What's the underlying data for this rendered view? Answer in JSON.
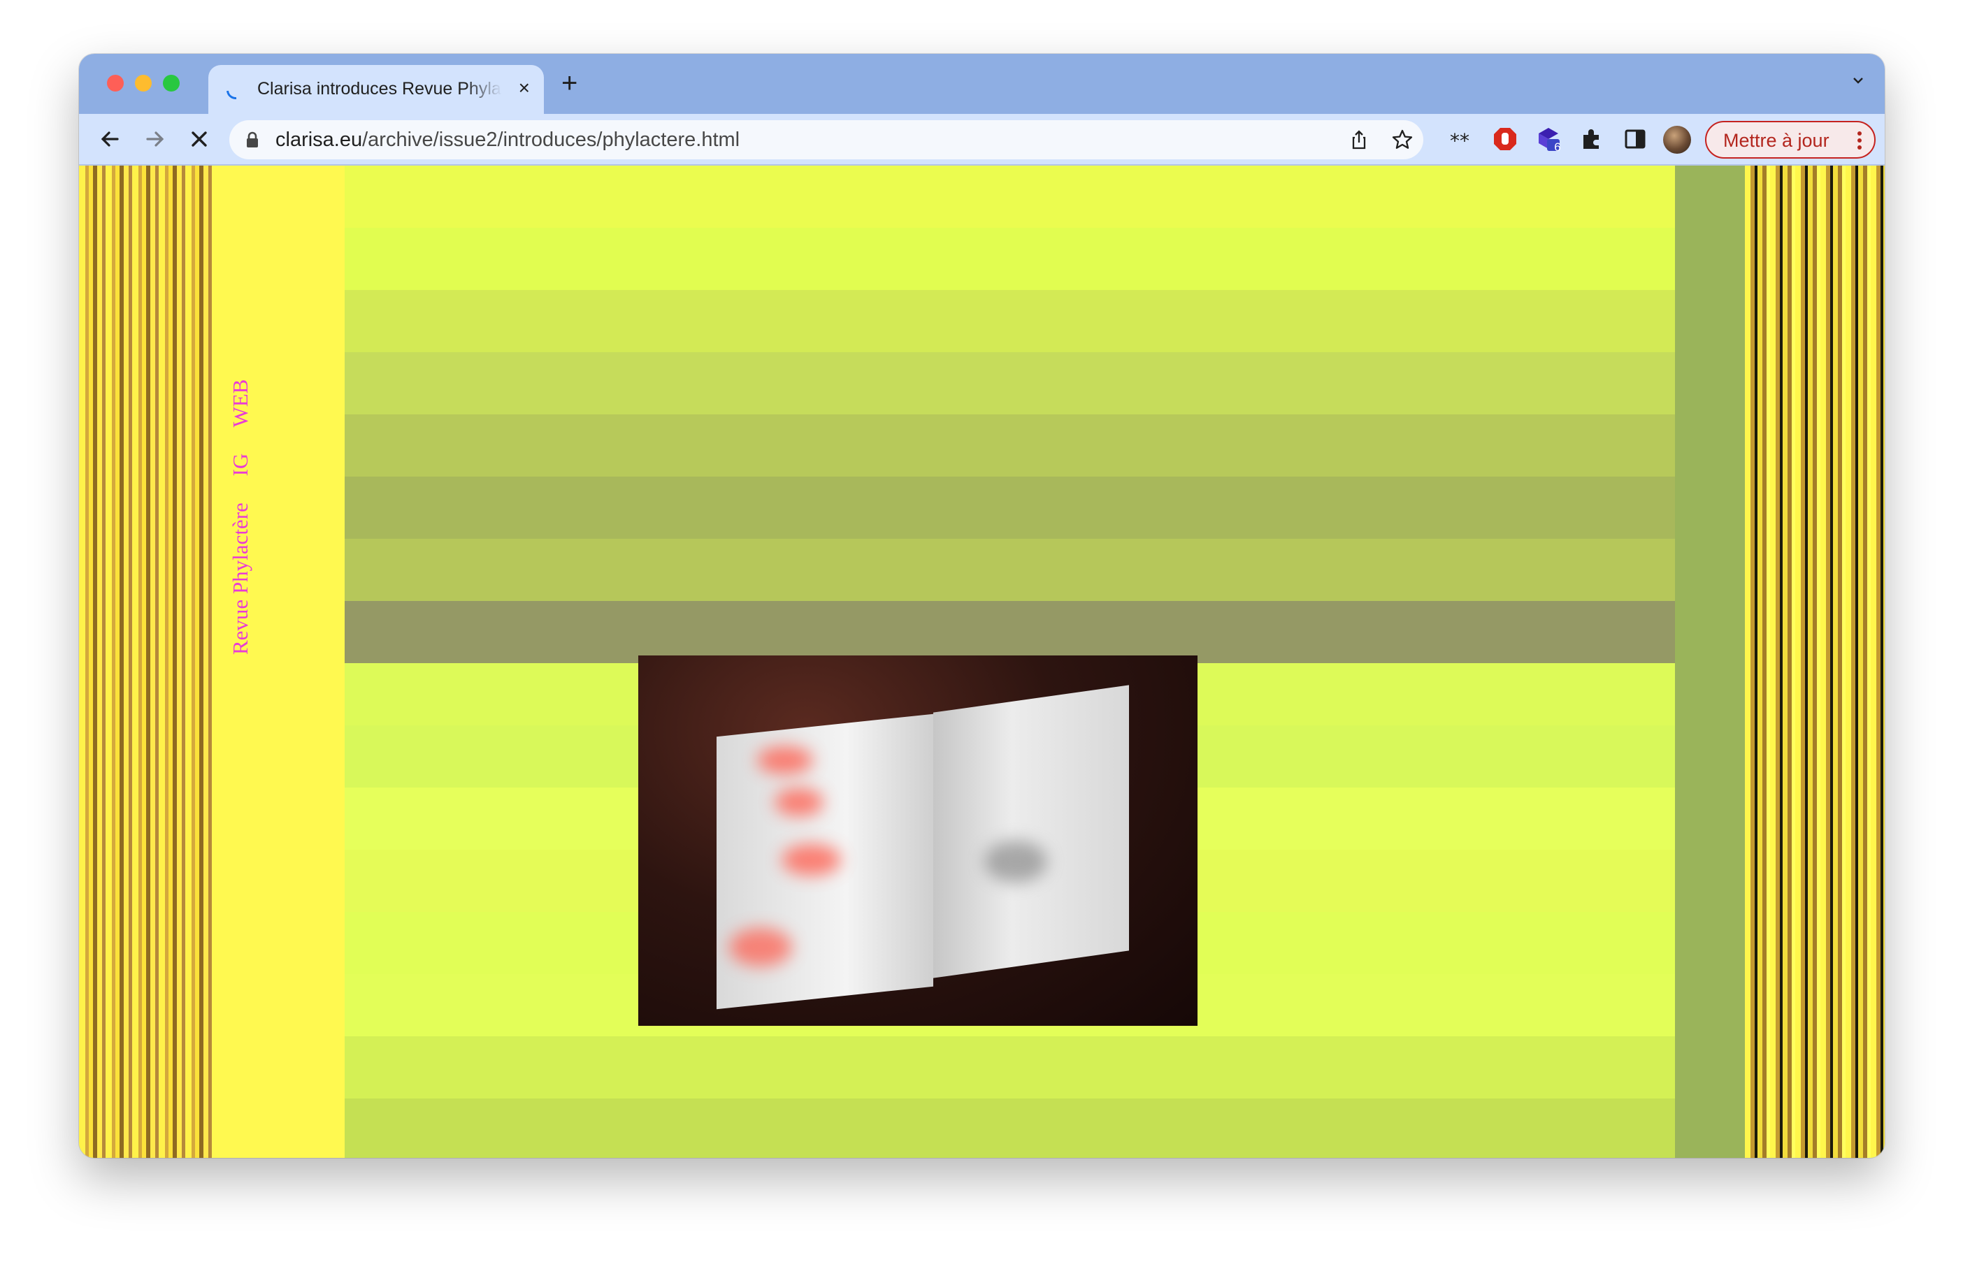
{
  "browser": {
    "tab": {
      "title": "Clarisa introduces Revue Phylactère",
      "close_icon": "×"
    },
    "new_tab_label": "+",
    "address_bar": {
      "host": "clarisa.eu",
      "path": "/archive/issue2/introduces/phylactere.html"
    },
    "extension_badge": "6",
    "update_button_label": "Mettre à jour"
  },
  "page": {
    "nav_links": [
      {
        "label": "Revue Phylactère"
      },
      {
        "label": "IG"
      },
      {
        "label": "WEB"
      }
    ],
    "band_colors": [
      "#ebfc4f",
      "#e1fd50",
      "#d3ea55",
      "#c6dc5b",
      "#b7c95a",
      "#a8b85b",
      "#b6c75a",
      "#959965",
      "#ddfa58",
      "#d8f85a",
      "#e6ff5b",
      "#e5fb57",
      "#e1fe56",
      "#e3fe58",
      "#d4f055",
      "#c5e053",
      "#b4c94b"
    ],
    "photo_subject": "open book on dark satin"
  }
}
